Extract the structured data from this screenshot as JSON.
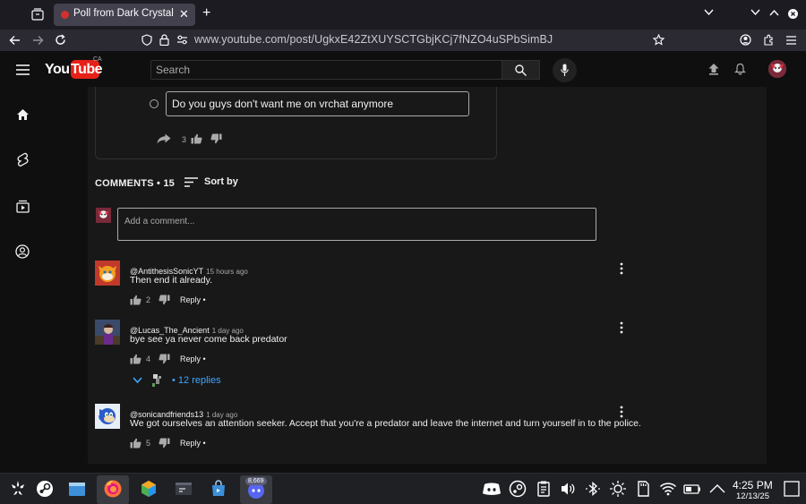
{
  "browser": {
    "tab_title": "Poll from Dark Crystal E",
    "url": "www.youtube.com/post/UgkxE42ZtXUYSCTGbjKCj7fNZO4uSPbSimBJ"
  },
  "header": {
    "logo_you": "You",
    "logo_tube": "Tube",
    "region": "CA",
    "search_placeholder": "Search"
  },
  "poll": {
    "option_text": "Do you guys don't want me on vrchat anymore",
    "like_count": "3"
  },
  "comments_section": {
    "title": "COMMENTS • 15",
    "sort_label": "Sort by",
    "add_placeholder": "Add a comment...",
    "replies_label": "• 12 replies"
  },
  "comments": [
    {
      "author": "@AntithesisSonicYT",
      "time": "15 hours ago",
      "body": "Then end it already.",
      "likes": "2",
      "reply": "Reply •"
    },
    {
      "author": "@Lucas_The_Ancient",
      "time": "1 day ago",
      "body": "bye see ya never come back predator",
      "likes": "4",
      "reply": "Reply •"
    },
    {
      "author": "@sonicandfriends13",
      "time": "1 day ago",
      "body": "We got ourselves an attention seeker. Accept that you're a predator and leave the internet and turn yourself in to the police.",
      "likes": "5",
      "reply": "Reply •"
    }
  ],
  "taskbar": {
    "discord_badge": "8,669",
    "time": "4:25 PM",
    "date": "12/13/25"
  },
  "colors": {
    "accent_red": "#e62117",
    "link_blue": "#3ea6ff",
    "panel_bg": "#181818",
    "page_bg": "#0f0f0f"
  }
}
